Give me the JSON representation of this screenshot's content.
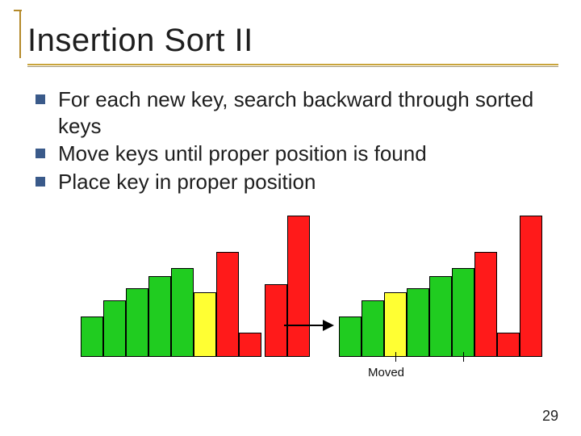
{
  "title": "Insertion Sort II",
  "bullets": [
    "For each new key, search backward through sorted keys",
    "Move keys until proper position is found",
    "Place key in proper position"
  ],
  "moved_label": "Moved",
  "page_number": "29",
  "chart_data": [
    {
      "type": "bar",
      "title": "",
      "xlabel": "",
      "ylabel": "",
      "ylim": [
        0,
        175
      ],
      "categories": [
        "0",
        "1",
        "2",
        "3",
        "4",
        "5",
        "6",
        "7"
      ],
      "series": [
        {
          "name": "height",
          "values": [
            50,
            70,
            85,
            100,
            110,
            80,
            130,
            30
          ]
        },
        {
          "name": "color",
          "values": [
            "green",
            "green",
            "green",
            "green",
            "green",
            "yellow",
            "red",
            "red"
          ]
        }
      ]
    },
    {
      "type": "bar",
      "title": "",
      "xlabel": "",
      "ylabel": "",
      "ylim": [
        0,
        175
      ],
      "categories": [
        "0",
        "1",
        "2",
        "3",
        "4",
        "5",
        "6",
        "7",
        "8"
      ],
      "series": [
        {
          "name": "height",
          "values": [
            50,
            70,
            80,
            85,
            100,
            110,
            130,
            30,
            175
          ]
        },
        {
          "name": "color",
          "values": [
            "green",
            "green",
            "yellow",
            "green",
            "green",
            "green",
            "red",
            "red",
            "red"
          ]
        }
      ]
    }
  ],
  "moved_tick_indices": [
    2,
    5
  ],
  "left_tail_bars": [
    {
      "height": 90,
      "color": "red"
    },
    {
      "height": 175,
      "color": "red"
    }
  ]
}
